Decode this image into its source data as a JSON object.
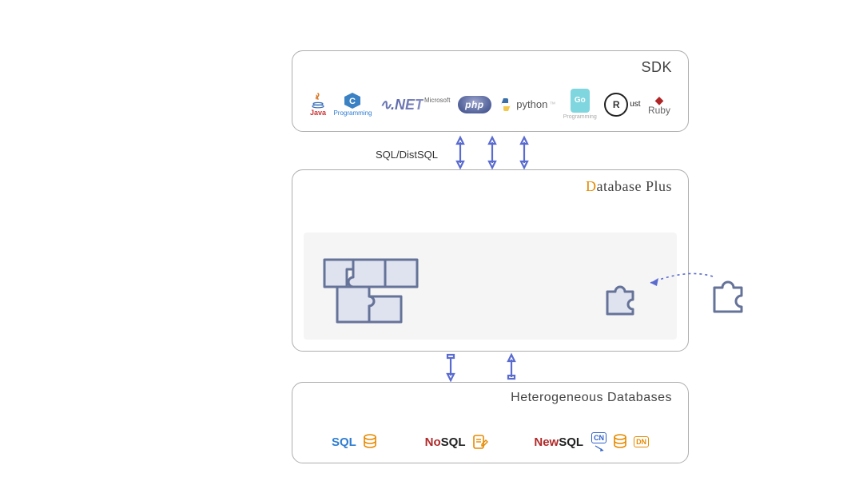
{
  "sdk": {
    "title": "SDK",
    "langs": {
      "java": "Java",
      "c": "Programming",
      "dotnet_brand": ".NET",
      "dotnet_vendor": "Microsoft",
      "php": "php",
      "python": "python",
      "go": "Go",
      "go_sub": "Programming",
      "rust_r": "R",
      "rust_rest": "ust",
      "ruby": "Ruby"
    }
  },
  "connector": {
    "label": "SQL/DistSQL"
  },
  "dbplus": {
    "title_d": "D",
    "title_rest": "atabase Plus"
  },
  "het": {
    "title": "Heterogeneous Databases",
    "sql": "SQL",
    "nosql_no": "No",
    "nosql_sql": "SQL",
    "newsql_new": "New",
    "newsql_sql": "SQL",
    "cn": "CN",
    "dn": "DN"
  }
}
